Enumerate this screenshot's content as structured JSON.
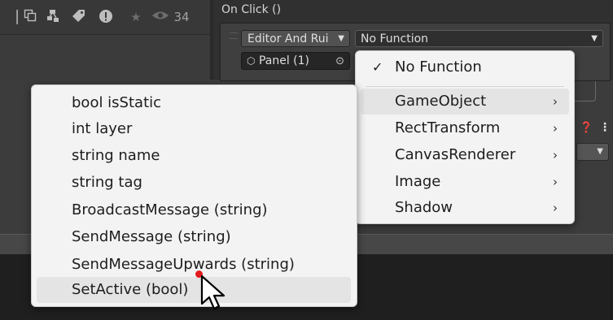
{
  "toolbar": {
    "icons": [
      "layers-icon",
      "prefab-icon",
      "tag-icon",
      "warning-icon",
      "favorite-icon",
      "visibility-icon"
    ],
    "visible_count": "34"
  },
  "event": {
    "title": "On Click ()",
    "runtime_dropdown": "Editor And Rui",
    "function_dropdown": "No Function",
    "object_field": "Panel (1)"
  },
  "function_menu": {
    "items": [
      {
        "label": "No Function",
        "checked": true
      },
      {
        "label": "GameObject",
        "submenu": true,
        "highlighted": true
      },
      {
        "label": "RectTransform",
        "submenu": true
      },
      {
        "label": "CanvasRenderer",
        "submenu": true
      },
      {
        "label": "Image",
        "submenu": true
      },
      {
        "label": "Shadow",
        "submenu": true
      }
    ]
  },
  "gameobject_submenu": {
    "items": [
      "bool isStatic",
      "int layer",
      "string name",
      "string tag",
      "BroadcastMessage (string)",
      "SendMessage (string)",
      "SendMessageUpwards (string)",
      "SetActive (bool)"
    ],
    "highlighted_index": 7
  },
  "colors": {
    "menu_bg": "#f3f3f3",
    "menu_highlight": "#e4e4e4",
    "pointer_dot": "#e31c1c"
  }
}
